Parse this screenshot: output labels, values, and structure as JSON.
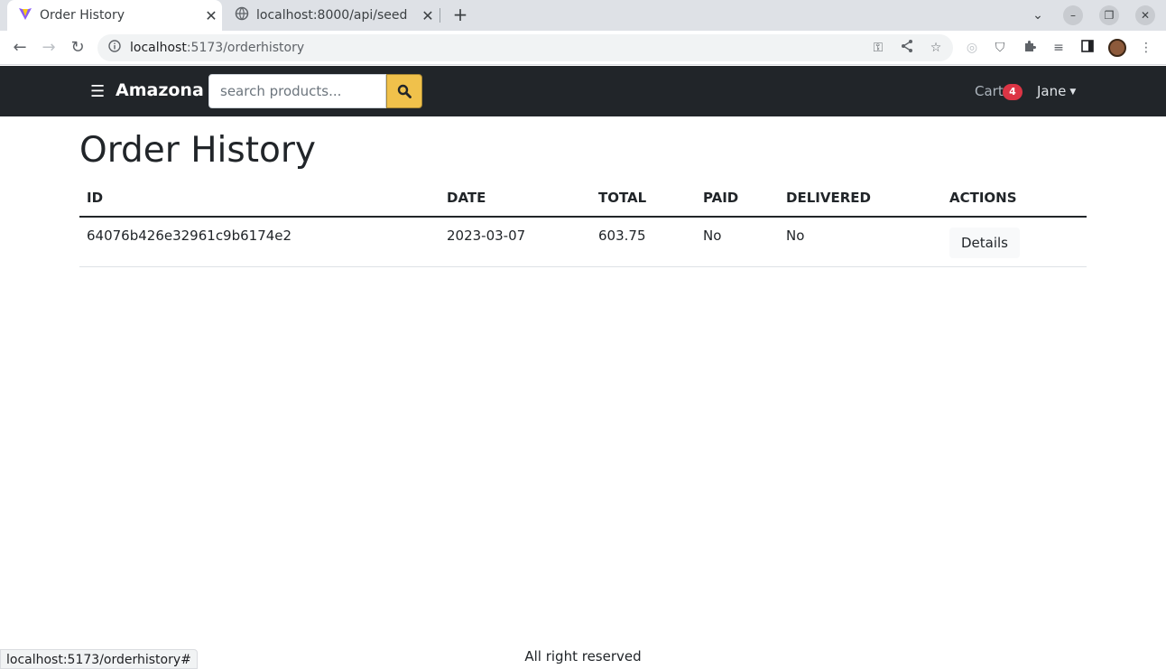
{
  "browser": {
    "tabs": [
      {
        "title": "Order History",
        "icon": "vite-icon",
        "close": "✕"
      },
      {
        "title": "localhost:8000/api/seed",
        "icon": "globe-icon",
        "close": "✕"
      }
    ],
    "new_tab": "+",
    "url_host": "localhost",
    "url_path": ":5173/orderhistory",
    "status_url": "localhost:5173/orderhistory#"
  },
  "navbar": {
    "brand": "Amazona",
    "search_placeholder": "search products...",
    "cart_label": "Cart",
    "cart_count": "4",
    "user_name": "Jane"
  },
  "page": {
    "title": "Order History",
    "columns": [
      "ID",
      "DATE",
      "TOTAL",
      "PAID",
      "DELIVERED",
      "ACTIONS"
    ],
    "rows": [
      {
        "id": "64076b426e32961c9b6174e2",
        "date": "2023-03-07",
        "total": "603.75",
        "paid": "No",
        "delivered": "No",
        "action": "Details"
      }
    ]
  },
  "footer": {
    "text": "All right reserved"
  },
  "colors": {
    "navbar_bg": "#212529",
    "search_button": "#f0c14b",
    "cart_badge": "#dc3545"
  }
}
